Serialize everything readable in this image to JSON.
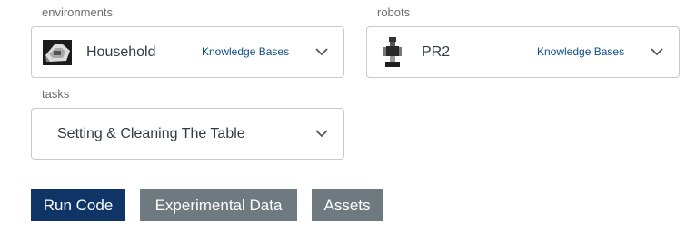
{
  "environments": {
    "label": "environments",
    "selected": "Household",
    "link": "Knowledge Bases",
    "thumbnail_icon": "household-scene-icon"
  },
  "robots": {
    "label": "robots",
    "selected": "PR2",
    "link": "Knowledge Bases",
    "thumbnail_icon": "pr2-robot-icon"
  },
  "tasks": {
    "label": "tasks",
    "selected": "Setting & Cleaning The Table"
  },
  "actions": {
    "run_code": "Run Code",
    "experimental_data": "Experimental Data",
    "assets": "Assets"
  },
  "colors": {
    "primary": "#0f3566",
    "secondary": "#6e7a80",
    "link": "#0f4d8a"
  }
}
